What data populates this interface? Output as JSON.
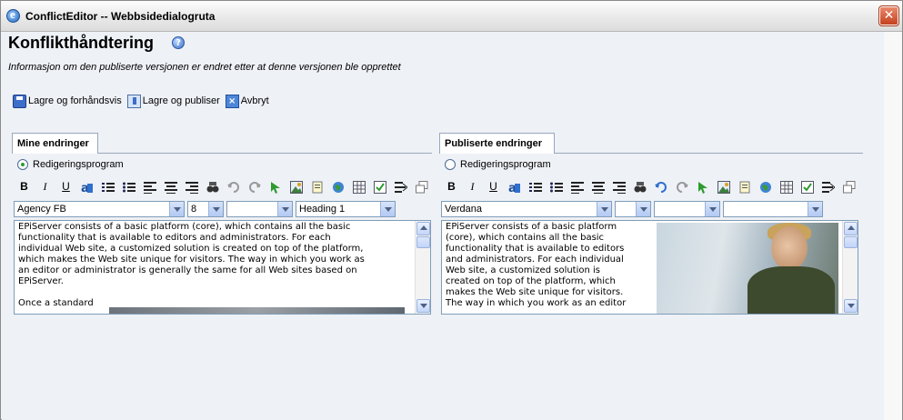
{
  "window": {
    "title": "ConflictEditor -- Webbsidedialogruta",
    "close_glyph": "✕"
  },
  "page": {
    "title": "Konflikthåndtering",
    "help_glyph": "?",
    "info": "Informasjon om den publiserte versjonen er endret etter at denne versjonen ble opprettet"
  },
  "toolbar": {
    "save_preview": "Lagre og forhåndsvis",
    "save_publish": "Lagre og publiser",
    "cancel": "Avbryt"
  },
  "left": {
    "tab": "Mine endringer",
    "radio_label": "Redigeringsprogram",
    "radio_selected": true,
    "font": "Agency FB",
    "size": "8",
    "style_blank": "",
    "block": "Heading 1",
    "text": "EPiServer consists of a basic platform (core), which contains all the basic\nfunctionality that is available to editors and administrators. For each\nindividual Web site, a customized solution is created on top of the platform,\nwhich makes the Web site unique for visitors. The way in which you work as\nan editor or administrator is generally the same for all Web sites based on\nEPiServer.\n\nOnce a standard"
  },
  "right": {
    "tab": "Publiserte endringer",
    "radio_label": "Redigeringsprogram",
    "radio_selected": false,
    "font": "Verdana",
    "size": "",
    "style_blank": "",
    "block": "",
    "text": "EPiServer consists of a basic platform\n(core), which contains all the basic\nfunctionality that is available to editors\nand administrators. For each individual\nWeb site, a customized solution is\ncreated on top of the platform, which\nmakes the Web site unique for visitors.\nThe way in which you work as an editor"
  },
  "format_buttons": [
    "B",
    "I",
    "U"
  ],
  "colors": {
    "tab_border": "#9aa7bc",
    "field_border": "#7f9db9",
    "close_red": "#c4401e"
  }
}
